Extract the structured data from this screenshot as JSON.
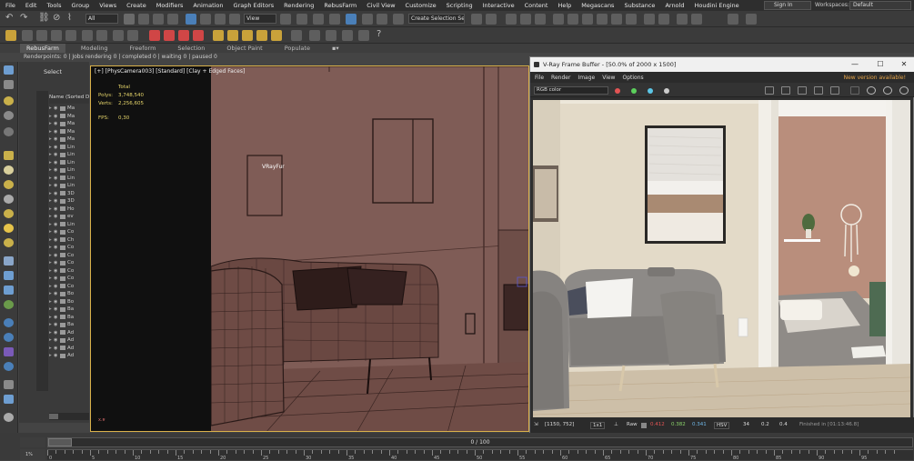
{
  "menu": {
    "items": [
      "File",
      "Edit",
      "Tools",
      "Group",
      "Views",
      "Create",
      "Modifiers",
      "Animation",
      "Graph Editors",
      "Rendering",
      "RebusFarm",
      "Civil View",
      "Customize",
      "Scripting",
      "Interactive",
      "Content",
      "Help",
      "Megascans",
      "Substance",
      "Arnold",
      "Houdini Engine"
    ],
    "sign_in": "Sign In",
    "workspaces_label": "Workspaces:",
    "workspaces_value": "Default"
  },
  "toolbar": {
    "filter_value": "All",
    "view_value": "View",
    "selection_set_placeholder": "Create Selection Se"
  },
  "ribbon": {
    "tabs": [
      "RebusFarm",
      "Modeling",
      "Freeform",
      "Selection",
      "Object Paint",
      "Populate"
    ],
    "active_tab": "RebusFarm",
    "status": "Renderpoints: 0 | Jobs rendering 0 | completed 0 | waiting 0 | paused 0"
  },
  "explorer": {
    "select_label": "Select",
    "header": "Name (Sorted De",
    "rows": [
      "Ma",
      "Ma",
      "Ma",
      "Ma",
      "Ma",
      "Lin",
      "Lin",
      "Lin",
      "Lin",
      "Lin",
      "Lin",
      "3D",
      "3D",
      "Ho",
      "ev",
      "Lin",
      "Co",
      "Ch",
      "Co",
      "Co",
      "Co",
      "Co",
      "Co",
      "Co",
      "Bo",
      "Bo",
      "Ba",
      "Ba",
      "Ba",
      "Ad",
      "Ad",
      "Ad",
      "Ad"
    ]
  },
  "viewport": {
    "label": "[+] [PhysCamera003] [Standard] [Clay + Edged Faces]",
    "stats_total": "Total",
    "polys_label": "Polys:",
    "polys_value": "3,748,540",
    "verts_label": "Verts:",
    "verts_value": "2,256,605",
    "fps_label": "FPS:",
    "fps_value": "0,30",
    "vrayfur": "VRayFur"
  },
  "vfb": {
    "title": "V-Ray Frame Buffer - [50.0% of 2000 x 1500]",
    "menu": [
      "File",
      "Render",
      "Image",
      "View",
      "Options"
    ],
    "new_version": "New version available!",
    "channel": "RGB color",
    "coords": "[1150, 752]",
    "zoom": "1x1",
    "raw_label": "Raw",
    "r_value": "0.412",
    "g_value": "0.382",
    "b_value": "0.341",
    "color_mode": "HSV",
    "h_value": "34",
    "s_value": "0.2",
    "v_value": "0.4",
    "finished": "Finished in [01:13:46.8]",
    "colors": {
      "red": "#e25454",
      "green": "#5ccf5c",
      "blue": "#5cc6e6",
      "r_text": "#e25454",
      "g_text": "#8ad36a",
      "b_text": "#6fb6e6"
    }
  },
  "timeline": {
    "slider_label": "0 / 100",
    "ticks": [
      "0",
      "5",
      "10",
      "15",
      "20",
      "25",
      "30",
      "35",
      "40",
      "45",
      "50",
      "55",
      "60",
      "65",
      "70",
      "75",
      "80",
      "85",
      "90",
      "95"
    ]
  }
}
